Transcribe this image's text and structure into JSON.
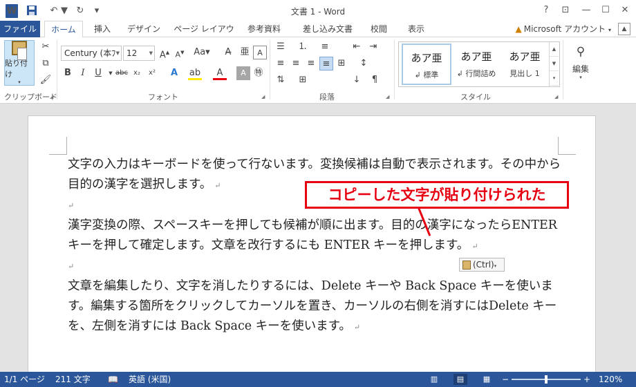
{
  "titlebar": {
    "app_icon_letter": "W",
    "title": "文書 1 - Word",
    "help": "?",
    "restore_ribbon": "⊡",
    "minimize": "—",
    "maximize": "☐",
    "close": "✕"
  },
  "tabs": [
    {
      "label": "ファイル"
    },
    {
      "label": "ホーム"
    },
    {
      "label": "挿入"
    },
    {
      "label": "デザイン"
    },
    {
      "label": "ページ レイアウト"
    },
    {
      "label": "参考資料"
    },
    {
      "label": "差し込み文書"
    },
    {
      "label": "校閲"
    },
    {
      "label": "表示"
    }
  ],
  "account": {
    "label": "Microsoft アカウント"
  },
  "ribbon": {
    "clipboard": {
      "paste_label": "貼り付け",
      "group_label": "クリップボード"
    },
    "font": {
      "font_name": "Century (本ﾌ",
      "font_size": "12",
      "group_label": "フォント"
    },
    "paragraph": {
      "group_label": "段落"
    },
    "styles": {
      "group_label": "スタイル",
      "items": [
        {
          "sample": "あア亜",
          "name": "↲ 標準"
        },
        {
          "sample": "あア亜",
          "name": "↲ 行間詰め"
        },
        {
          "sample": "あア亜",
          "name": "見出し 1"
        }
      ]
    },
    "editing": {
      "label": "編集"
    }
  },
  "document": {
    "paragraphs": [
      "文字の入力はキーボードを使って行ないます。変換候補は自動で表示されます。その中から目的の漢字を選択します。",
      "",
      "漢字変換の際、スペースキーを押しても候補が順に出ます。目的の漢字になったらENTER キーを押して確定します。文章を改行するにも ENTER キーを押します。",
      "",
      "文章を編集したり、文字を消したりするには、Delete キーや Back Space キーを使います。編集する箇所をクリックしてカーソルを置き、カーソルの右側を消すにはDelete キーを、左側を消すには Back Space キーを使います。"
    ],
    "paragraph_mark": "↵"
  },
  "callout": {
    "text": "コピーした文字が貼り付けられた"
  },
  "paste_options": {
    "label": "(Ctrl)"
  },
  "statusbar": {
    "page": "1/1 ページ",
    "words": "211 文字",
    "language": "英語 (米国)",
    "zoom": "120%"
  },
  "colors": {
    "accent": "#2b579a",
    "callout": "#e60012"
  }
}
